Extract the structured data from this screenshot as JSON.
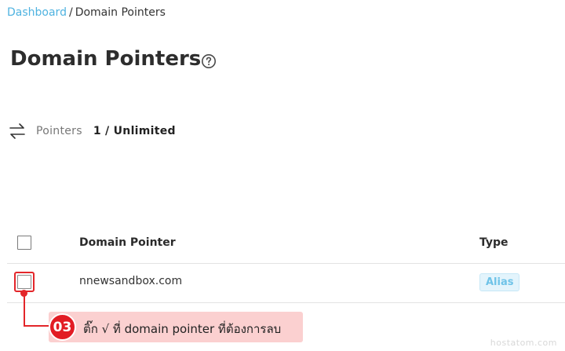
{
  "breadcrumb": {
    "link": "Dashboard",
    "separator": "/",
    "current": "Domain Pointers"
  },
  "page": {
    "title": "Domain Pointers",
    "help_icon": "question-circle-icon"
  },
  "pointers": {
    "icon": "swap-arrows-icon",
    "label": "Pointers",
    "value": "1 / Unlimited"
  },
  "table": {
    "headers": {
      "domain": "Domain Pointer",
      "type": "Type"
    },
    "rows": [
      {
        "domain": "nnewsandbox.com",
        "type": "Alias"
      }
    ]
  },
  "annotation": {
    "step": "03",
    "text": "ติ๊ก √ ที่ domain pointer ที่ต้องการลบ"
  },
  "watermark": "hostatom.com",
  "colors": {
    "link": "#4fb3e0",
    "annotation_red": "#e21c24",
    "annotation_bg": "#fbd0d0",
    "badge_text": "#6fc3e8",
    "badge_bg": "#e3f4fc"
  }
}
